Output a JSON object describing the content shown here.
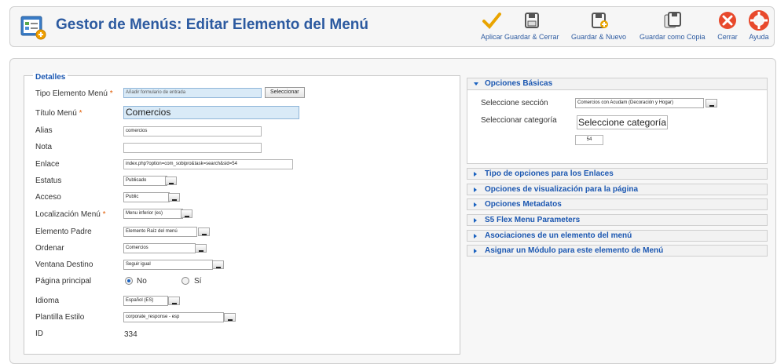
{
  "header": {
    "title": "Gestor de Menús: Editar Elemento del Menú",
    "toolbar": [
      {
        "key": "apply",
        "label": "Aplicar",
        "icon": "check-icon",
        "color": "#e9a400"
      },
      {
        "key": "save-close",
        "label": "Guardar & Cerrar",
        "icon": "save-icon",
        "color": "#555555"
      },
      {
        "key": "save-new",
        "label": "Guardar & Nuevo",
        "icon": "save-new-icon",
        "color": "#555555"
      },
      {
        "key": "save-copy",
        "label": "Guardar como Copia",
        "icon": "save-copy-icon",
        "color": "#555555"
      },
      {
        "key": "close",
        "label": "Cerrar",
        "icon": "close-icon",
        "color": "#e8492c"
      },
      {
        "key": "help",
        "label": "Ayuda",
        "icon": "help-icon",
        "color": "#e8492c"
      }
    ]
  },
  "details": {
    "legend": "Detalles",
    "fields": {
      "type": {
        "label": "Tipo Elemento Menú",
        "required": "*",
        "value": "Añadir formulario de entrada",
        "button": "Seleccionar"
      },
      "title": {
        "label": "Título Menú",
        "required": "*",
        "value": "Comercios"
      },
      "alias": {
        "label": "Alias",
        "value": "comercios"
      },
      "note": {
        "label": "Nota",
        "value": ""
      },
      "link": {
        "label": "Enlace",
        "value": "index.php?option=com_sobipro&task=search&sid=54"
      },
      "status": {
        "label": "Estatus",
        "value": "Publicado"
      },
      "access": {
        "label": "Acceso",
        "value": "Public"
      },
      "menu_location": {
        "label": "Localización Menú",
        "required": "*",
        "value": "Menu inferior (es)"
      },
      "parent": {
        "label": "Elemento Padre",
        "value": "Elemento Raíz del menú"
      },
      "order": {
        "label": "Ordenar",
        "value": "Comercios"
      },
      "target": {
        "label": "Ventana Destino",
        "value": "Seguir igual"
      },
      "home": {
        "label": "Página principal",
        "option_no": "No",
        "option_yes": "Sí"
      },
      "language": {
        "label": "Idioma",
        "value": "Español (ES)"
      },
      "template": {
        "label": "Plantilla Estilo",
        "value": "corporate_response - esp"
      },
      "id": {
        "label": "ID",
        "value": "334"
      }
    }
  },
  "options": {
    "basic": {
      "title": "Opciones Básicas",
      "section_label": "Seleccione sección",
      "section_value": "Comercios con Acudam (Decoración y Hogar)",
      "category_label": "Seleccionar categoría",
      "category_button": "Seleccione categoría",
      "category_id": "54"
    },
    "panels": [
      "Tipo de opciones para los Enlaces",
      "Opciones de visualización para la página",
      "Opciones Metadatos",
      "S5 Flex Menu Parameters",
      "Asociaciones de un elemento del menú",
      "Asignar un Módulo para este elemento de Menú"
    ]
  }
}
